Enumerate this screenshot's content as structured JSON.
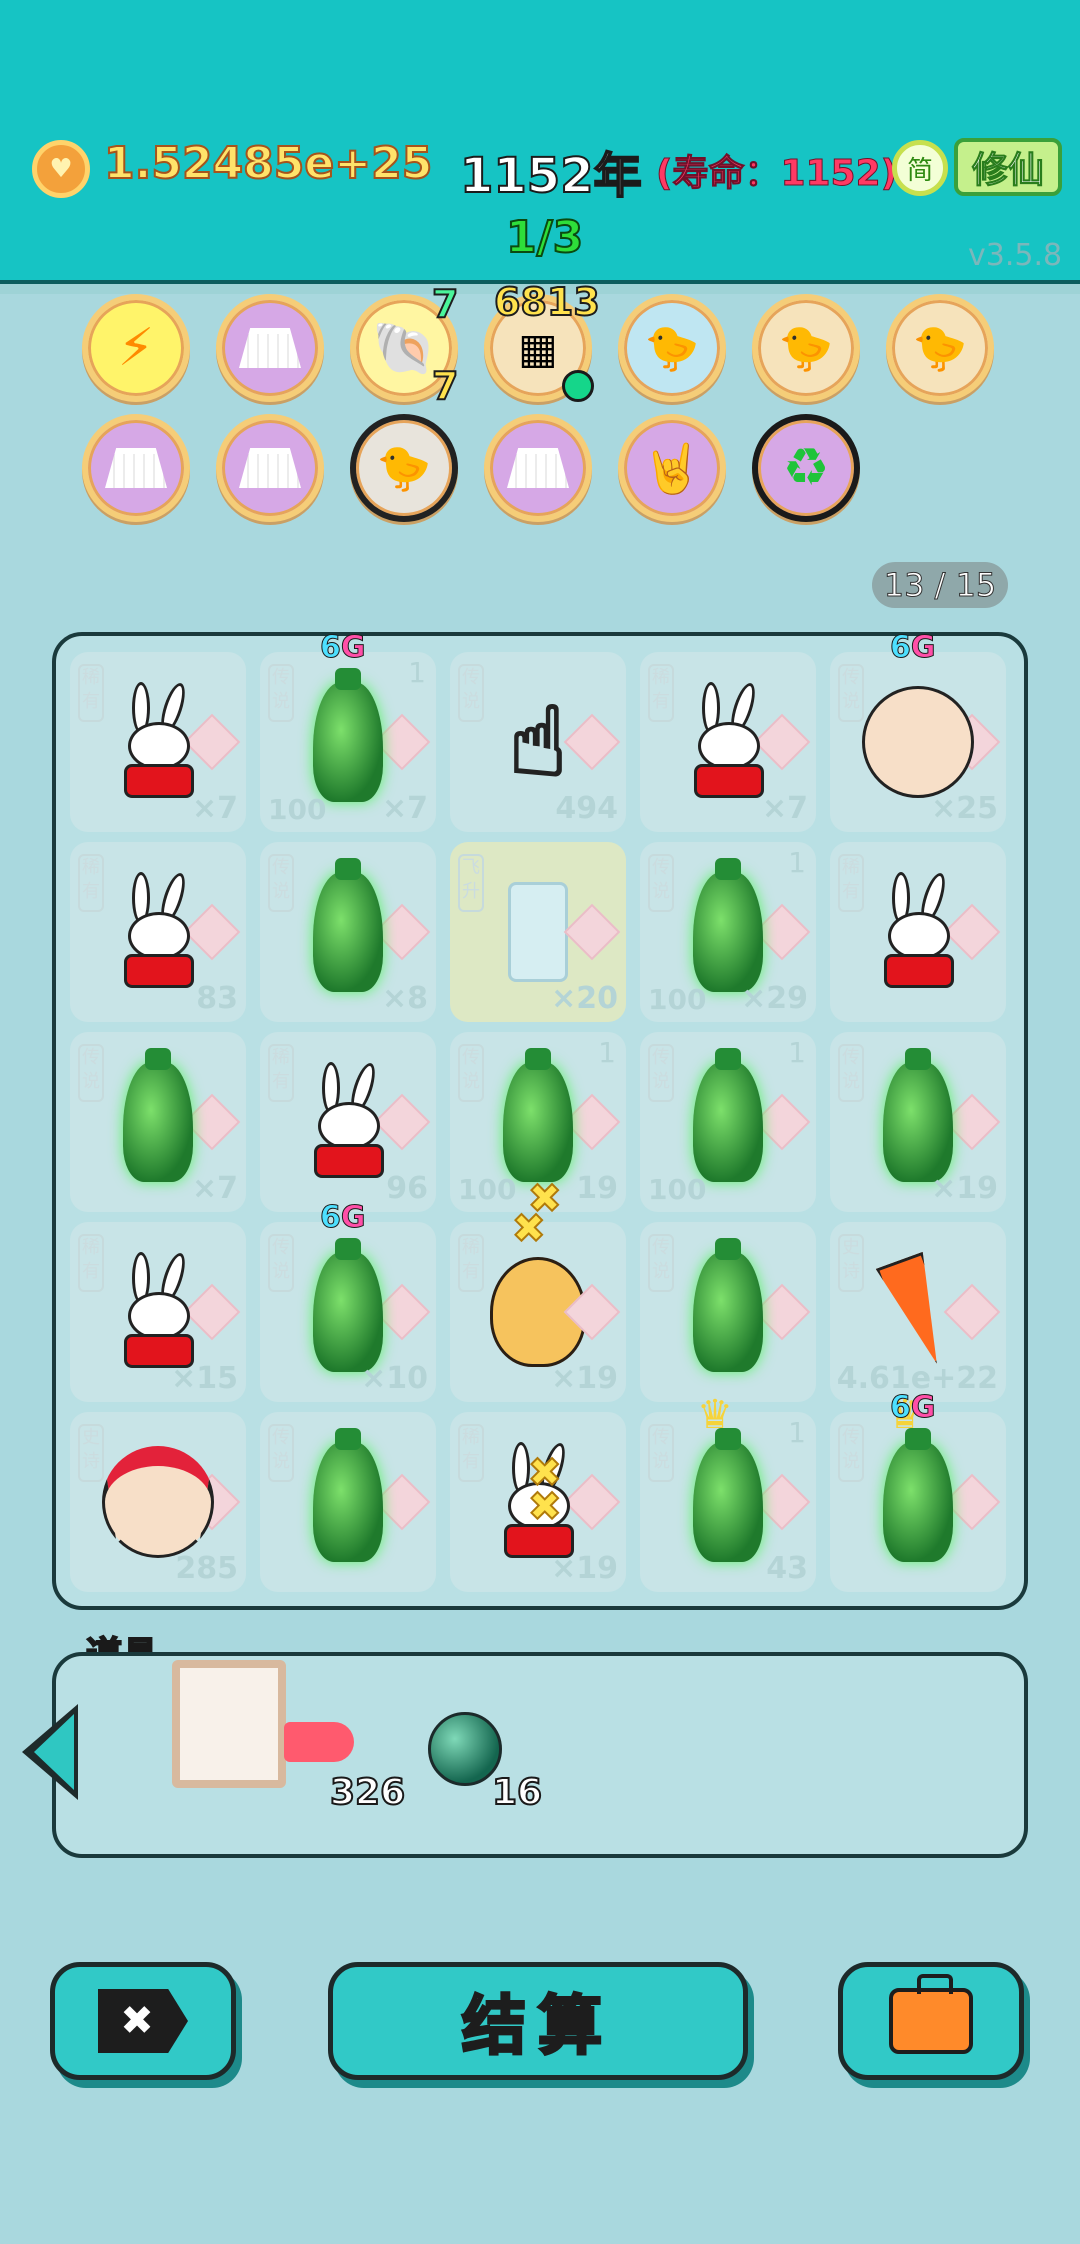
{
  "header": {
    "currency_value": "1.52485e+25",
    "year": "1152年",
    "lifespan": "(寿命：1152)",
    "simplified_label": "简",
    "mode_label": "修仙",
    "stage": "1/3",
    "version": "v3.5.8"
  },
  "skills_row1": [
    {
      "icon": "lightning-icon"
    },
    {
      "icon": "skirt-icon"
    },
    {
      "icon": "shell-icon",
      "top": "7",
      "bottom": "7"
    },
    {
      "icon": "egg-tray-icon",
      "top": "6813"
    },
    {
      "icon": "syringe-chick-icon"
    },
    {
      "icon": "chick-egg-icon"
    },
    {
      "icon": "chick-egg-icon"
    }
  ],
  "skills_row2": [
    {
      "icon": "skirt-icon"
    },
    {
      "icon": "skirt-icon"
    },
    {
      "icon": "chick-egg-icon"
    },
    {
      "icon": "skirt-icon"
    },
    {
      "icon": "rock-hand-icon"
    },
    {
      "icon": "recycle-icon"
    }
  ],
  "board": {
    "page_indicator": "13 / 15",
    "cells": [
      {
        "tag": "稀有",
        "item": "rabbit",
        "qty": "×7"
      },
      {
        "tag": "传说",
        "item": "vase",
        "qty": "×7",
        "level": "100",
        "corner": "1",
        "badge_g": "6",
        "badge_suffix": "G"
      },
      {
        "tag": "传说",
        "item": "pointer",
        "qty": "494"
      },
      {
        "tag": "稀有",
        "item": "rabbit",
        "qty": "×7"
      },
      {
        "tag": "传说",
        "item": "old-man",
        "qty": "×25",
        "badge_g": "6",
        "badge_suffix": "G"
      },
      {
        "tag": "稀有",
        "item": "rabbit",
        "qty": "83"
      },
      {
        "tag": "传说",
        "item": "vase",
        "qty": "×8"
      },
      {
        "tag": "飞升",
        "item": "fridge",
        "qty": "×20"
      },
      {
        "tag": "传说",
        "item": "vase",
        "qty": "×29",
        "level": "100",
        "corner": "1"
      },
      {
        "tag": "稀有",
        "item": "rabbit",
        "qty": ""
      },
      {
        "tag": "传说",
        "item": "vase",
        "qty": "×7"
      },
      {
        "tag": "稀有",
        "item": "rabbit",
        "qty": "96"
      },
      {
        "tag": "传说",
        "item": "vase",
        "qty": "19",
        "level": "100",
        "corner": "1"
      },
      {
        "tag": "传说",
        "item": "vase",
        "qty": "",
        "level": "100",
        "corner": "1"
      },
      {
        "tag": "传说",
        "item": "vase",
        "qty": "×19"
      },
      {
        "tag": "稀有",
        "item": "rabbit",
        "qty": "×15"
      },
      {
        "tag": "传说",
        "item": "vase",
        "qty": "×10",
        "badge_g": "6",
        "badge_suffix": "G"
      },
      {
        "tag": "稀有",
        "item": "chick",
        "qty": "×19"
      },
      {
        "tag": "传说",
        "item": "vase",
        "qty": ""
      },
      {
        "tag": "史诗",
        "item": "carrot",
        "qty": "4.61e+22"
      },
      {
        "tag": "史诗",
        "item": "boy",
        "qty": "285"
      },
      {
        "tag": "传说",
        "item": "vase",
        "qty": ""
      },
      {
        "tag": "稀有",
        "item": "rabbit",
        "qty": "×19"
      },
      {
        "tag": "传说",
        "item": "vase-crown",
        "qty": "43",
        "corner": "1"
      },
      {
        "tag": "传说",
        "item": "vase-crown",
        "qty": "",
        "badge_g": "6",
        "badge_suffix": "G"
      }
    ]
  },
  "items_panel": {
    "title": "道具",
    "items": [
      {
        "icon": "frame-lipstick-icon",
        "count": "326"
      },
      {
        "icon": "jade-orb-icon",
        "count": "16"
      }
    ]
  },
  "buttons": {
    "close_symbol": "✖",
    "settle_label": "结算"
  },
  "colors": {
    "header_bg": "#16c4c4",
    "body_bg": "#a9d8de",
    "accent_gold": "#ffe36a",
    "lifespan_red": "#ff3a64",
    "stage_green": "#2ede3a"
  }
}
